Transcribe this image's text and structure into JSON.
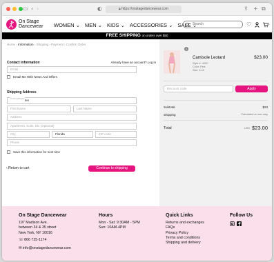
{
  "browser": {
    "url": "https://onstagedancewear.com"
  },
  "header": {
    "brand_line1": "On Stage",
    "brand_line2": "Dancewear",
    "nav": [
      {
        "label": "WOMEN"
      },
      {
        "label": "MEN"
      },
      {
        "label": "KIDS"
      },
      {
        "label": "ACCESSORIES"
      },
      {
        "label": "SALE"
      }
    ],
    "search_placeholder": "Search"
  },
  "banner": {
    "text": "FREE SHIPPING",
    "subtext": "on orders over $50"
  },
  "breadcrumb": [
    {
      "label": "Home",
      "current": false
    },
    {
      "label": "Information",
      "current": true
    },
    {
      "label": "Shipping",
      "current": false
    },
    {
      "label": "Payment",
      "current": false
    },
    {
      "label": "Confirm Order",
      "current": false
    }
  ],
  "contact": {
    "title": "Contact information",
    "account_prompt": "Already have an account? Log in",
    "email_placeholder": "Email",
    "newsletter_label": "Email Me With News And Offers"
  },
  "shipping": {
    "title": "Shipping Address",
    "country_label": "Country/Region",
    "country_value": "United States",
    "first_name": "First Name",
    "last_name": "Last Name",
    "address": "Address",
    "apartment": "Apartment, Suite, Etc (Optional)",
    "city": "City",
    "state_value": "Florida",
    "zip": "ZIP code",
    "phone": "Phone",
    "save_label": "Save this information for next time"
  },
  "actions": {
    "return_label": "Return to cart",
    "continue_label": "Continue to shipping"
  },
  "order": {
    "quantity": "1",
    "product_name": "Camisole Leotard",
    "product_price": "$23.00",
    "style": "Style #: 400C",
    "color": "Color: Pink",
    "size": "Size: 6-10",
    "discount_placeholder": "Discount code",
    "apply_label": "Apply",
    "subtotal_label": "Subtotal",
    "subtotal_value": "$23",
    "shipping_label": "Shipping",
    "shipping_value": "Calculated at next step",
    "total_label": "Total",
    "currency": "USD",
    "total_value": "$23.00"
  },
  "footer": {
    "store": {
      "title": "On Stage Dancewear",
      "address1": "197 Madison Ave.",
      "address2": "between 34 & 35 street",
      "address3": "New York, NY 10016",
      "phone": "866 725-1174",
      "email": "info@onstagedancewear.com"
    },
    "hours": {
      "title": "Hours",
      "line1": "Mon - Sat: 9:30AM - 5PM",
      "line2": "Sun: 10AM-4PM"
    },
    "links": {
      "title": "Quick Links",
      "items": [
        "Returns and exchanges",
        "FAQs",
        "Privacy Policy",
        "Terms and conditions",
        "Shipping and delivery"
      ]
    },
    "follow": {
      "title": "Follow Us",
      "icons": [
        "instagram-icon",
        "facebook-icon"
      ]
    }
  },
  "colors": {
    "accent": "#e5147e",
    "footer_bg": "#fbe0eb",
    "summary_bg": "#f1f1f1"
  }
}
